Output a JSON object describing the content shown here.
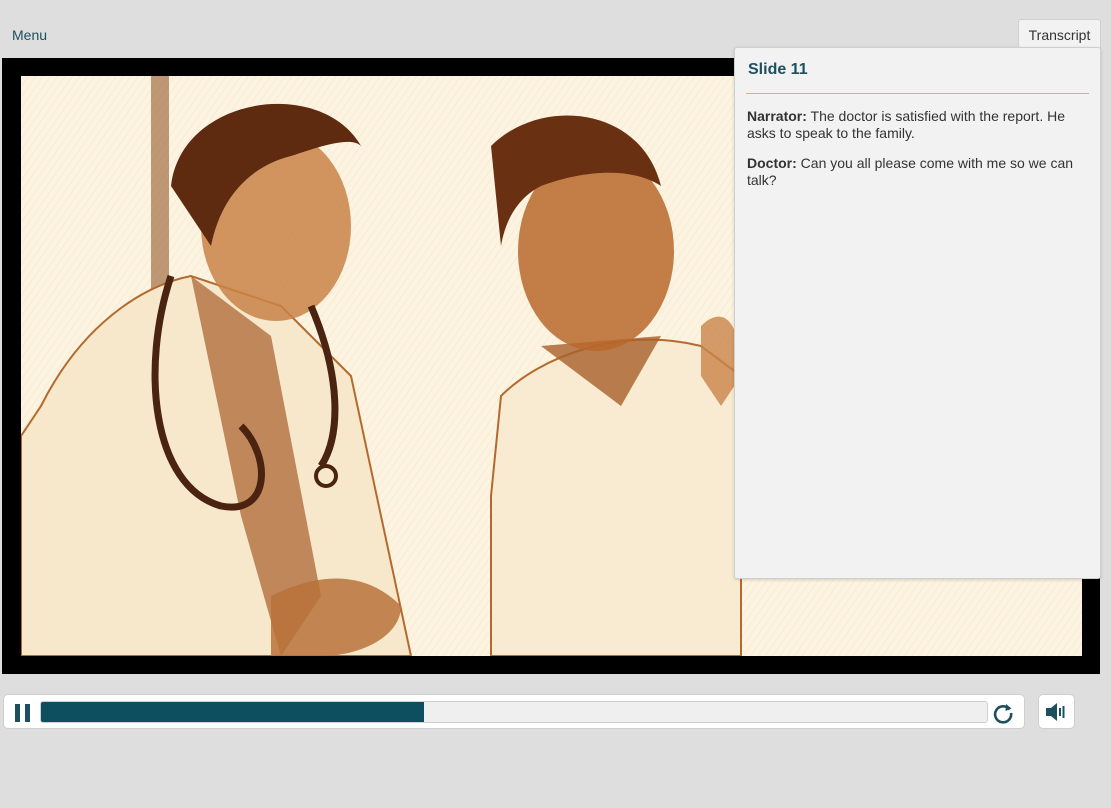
{
  "nav": {
    "menu_label": "Menu",
    "transcript_tab_label": "Transcript"
  },
  "transcript": {
    "title": "Slide 11",
    "lines": [
      {
        "speaker": "Narrator:",
        "text": "The doctor is satisfied with the report. He asks to speak to the family."
      },
      {
        "speaker": "Doctor:",
        "text": "Can you all please come with me so we can talk?"
      }
    ]
  },
  "player": {
    "progress_fraction": 0.405
  },
  "icons": {
    "pause": "pause-icon",
    "replay": "replay-icon",
    "volume": "volume-icon"
  },
  "colors": {
    "accent": "#1d4f5e",
    "progress": "#0d4f5e",
    "divider": "#e8a58c"
  }
}
